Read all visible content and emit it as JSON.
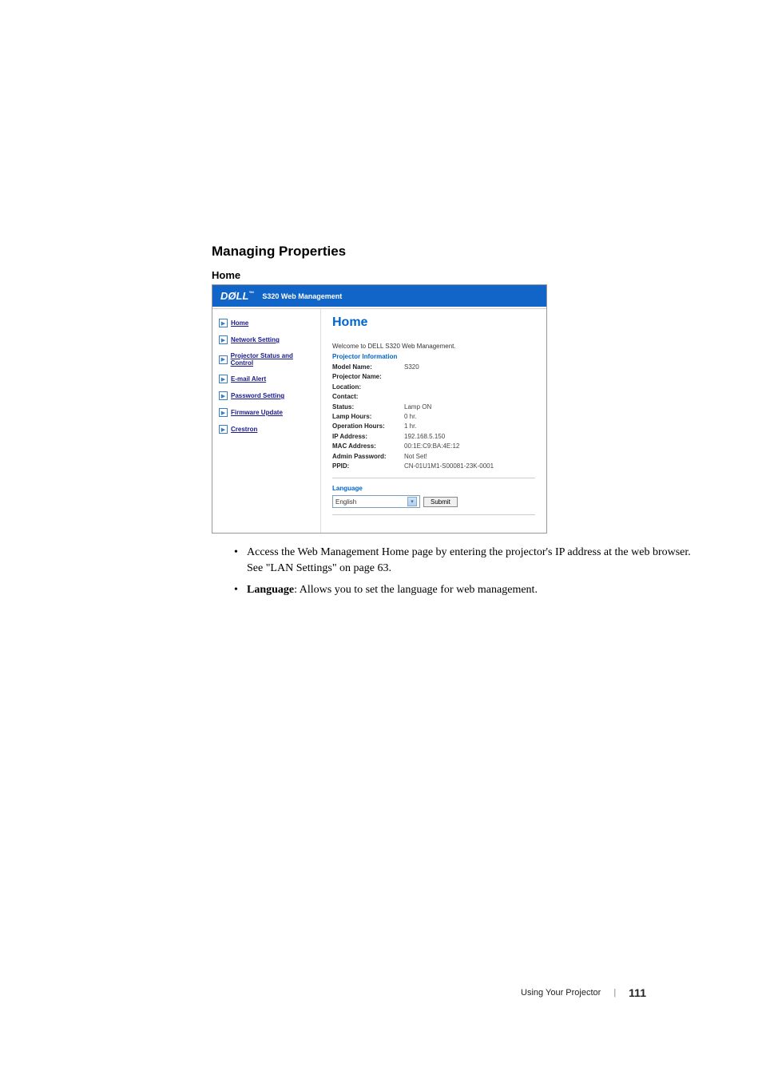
{
  "section_heading": "Managing Properties",
  "subsection_heading": "Home",
  "screenshot": {
    "header": {
      "logo": "DØLL",
      "tm": "™",
      "title": "S320 Web Management"
    },
    "sidebar": {
      "items": [
        {
          "label": "Home"
        },
        {
          "label": "Network Setting"
        },
        {
          "label": "Projector Status and Control"
        },
        {
          "label": "E-mail Alert"
        },
        {
          "label": "Password Setting"
        },
        {
          "label": "Firmware Update"
        },
        {
          "label": "Crestron"
        }
      ]
    },
    "panel": {
      "title": "Home",
      "welcome": "Welcome to DELL S320 Web Management.",
      "info_heading": "Projector Information",
      "rows": [
        {
          "label": "Model Name:",
          "value": "S320"
        },
        {
          "label": "Projector Name:",
          "value": ""
        },
        {
          "label": "Location:",
          "value": ""
        },
        {
          "label": "Contact:",
          "value": ""
        },
        {
          "label": "Status:",
          "value": "Lamp ON"
        },
        {
          "label": "Lamp Hours:",
          "value": "0 hr."
        },
        {
          "label": "Operation Hours:",
          "value": "1 hr."
        },
        {
          "label": "IP Address:",
          "value": "192.168.5.150"
        },
        {
          "label": "MAC Address:",
          "value": "00:1E:C9:BA:4E:12"
        },
        {
          "label": "Admin Password:",
          "value": "Not Set!"
        },
        {
          "label": "PPID:",
          "value": "CN-01U1M1-S00081-23K-0001"
        }
      ],
      "lang_heading": "Language",
      "lang_value": "English",
      "submit_label": "Submit"
    }
  },
  "bullets": [
    {
      "text": "Access the Web Management Home page by entering the projector's IP address at the web browser. See \"LAN Settings\" on page 63."
    },
    {
      "bold": "Language",
      "text": ": Allows you to set the language for web management."
    }
  ],
  "footer": {
    "section": "Using Your Projector",
    "page": "111"
  }
}
